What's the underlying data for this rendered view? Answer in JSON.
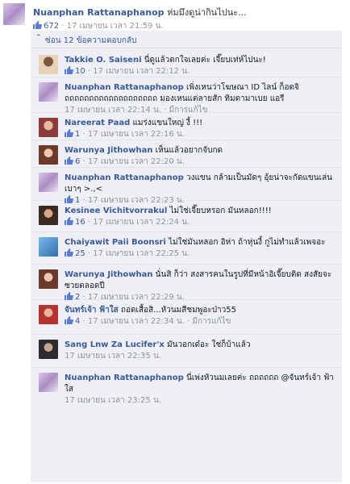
{
  "top_comment": {
    "author": "Nuanphan Rattanaphanop",
    "text": "ห่มมึงดูน่ากินไปนะ...",
    "likes": "672",
    "time": "17 เมษายน เวลา 21:59 น."
  },
  "replies_toggle": "ซ่อน 12 ข้อความตอบกลับ",
  "replies": [
    {
      "author": "Takkie O. Saiseni",
      "text": "นี่ดูแล้วตกใจเลยค่ะ เจี๊ยบเท่ห์ไปนะ!",
      "likes": "10",
      "time": "17 เมษายน เวลา 22:12 น.",
      "edited": ""
    },
    {
      "author": "Nuanphan Rattanaphanop",
      "text": "เพิ่งเหนว่าโฆษณา ID ไลน์ ก็อตจิ ถถถถถถถถถถถถถถถถถถถ มองเหนแต่ลายสัก ทิมตามาเบย แอรี",
      "likes": "",
      "time": "17 เมษายน เวลา 22:14 น.",
      "edited": "มีการแก้ไข"
    },
    {
      "author": "Nareerat Paad",
      "text": "แมร่งแขนใหญ่ งี้ !!!",
      "likes": "1",
      "time": "17 เมษายน เวลา 22:16 น.",
      "edited": ""
    },
    {
      "author": "Warunya Jithowhan",
      "text": "เห็นแล้วอยากจับกด",
      "likes": "6",
      "time": "17 เมษายน เวลา 22:20 น.",
      "edited": ""
    },
    {
      "author": "Nuanphan Rattanaphanop",
      "text": "วงแขน กล้ามเป็นมัดๆ อุ้ยน่าจะกัดแขนเล่นเบาๆ >.,<",
      "likes": "1",
      "time": "17 เมษายน เวลา 22:23 น.",
      "edited": ""
    },
    {
      "author": "Kesinee Vichitvorrakul",
      "text": "ไม่ใช่เจี๊ยบหรอก มันหลอก!!!!",
      "likes": "16",
      "time": "17 เมษายน เวลา 22:24 น.",
      "edited": ""
    },
    {
      "author": "Chaiyawit Paii Boonsri",
      "text": "ไม่ใช่มันหลอก อิห่า ถ้าหุ่นงี้ กูไม่ทำแล้วเพจอะ",
      "likes": "25",
      "time": "17 เมษายน เวลา 22:25 น.",
      "edited": ""
    },
    {
      "author": "Warunya Jithowhan",
      "text": "นั่นสิ ก็ว่า สงสารคนในรูปที่มีหน้าอิเจี๊ยบติด สงสัยจะซวยตลอดปี",
      "likes": "2",
      "time": "17 เมษายน เวลา 22:29 น.",
      "edited": ""
    },
    {
      "author": "จันทร์เจ้า ฟ้าใส",
      "text": "ถอดเสื้อสิ...หัวนมสีชมพูอะป่าว55",
      "likes": "4",
      "time": "17 เมษายน เวลา 22:34 น.",
      "edited": "มีการแก้ไข"
    },
    {
      "author": "Sang Lnw Za Lucifer'x",
      "text": "มันวอกเด๋อะ ใช่ก็บ้าแล้ว",
      "likes": "",
      "time": "17 เมษายน เวลา 22:35 น.",
      "edited": ""
    },
    {
      "author": "Nuanphan Rattanaphanop",
      "text": "นี่เพ่งหัวนมเลยค่ะ ถถถถถถ @จันทร์เจ้า ฟ้าใส",
      "likes": "",
      "time": "17 เมษายน เวลา 23:25 น.",
      "edited": ""
    }
  ],
  "separator": " · ",
  "colors": {
    "link": "#3b5998",
    "meta": "#90949c",
    "reply_bg": "#eef0f5"
  }
}
